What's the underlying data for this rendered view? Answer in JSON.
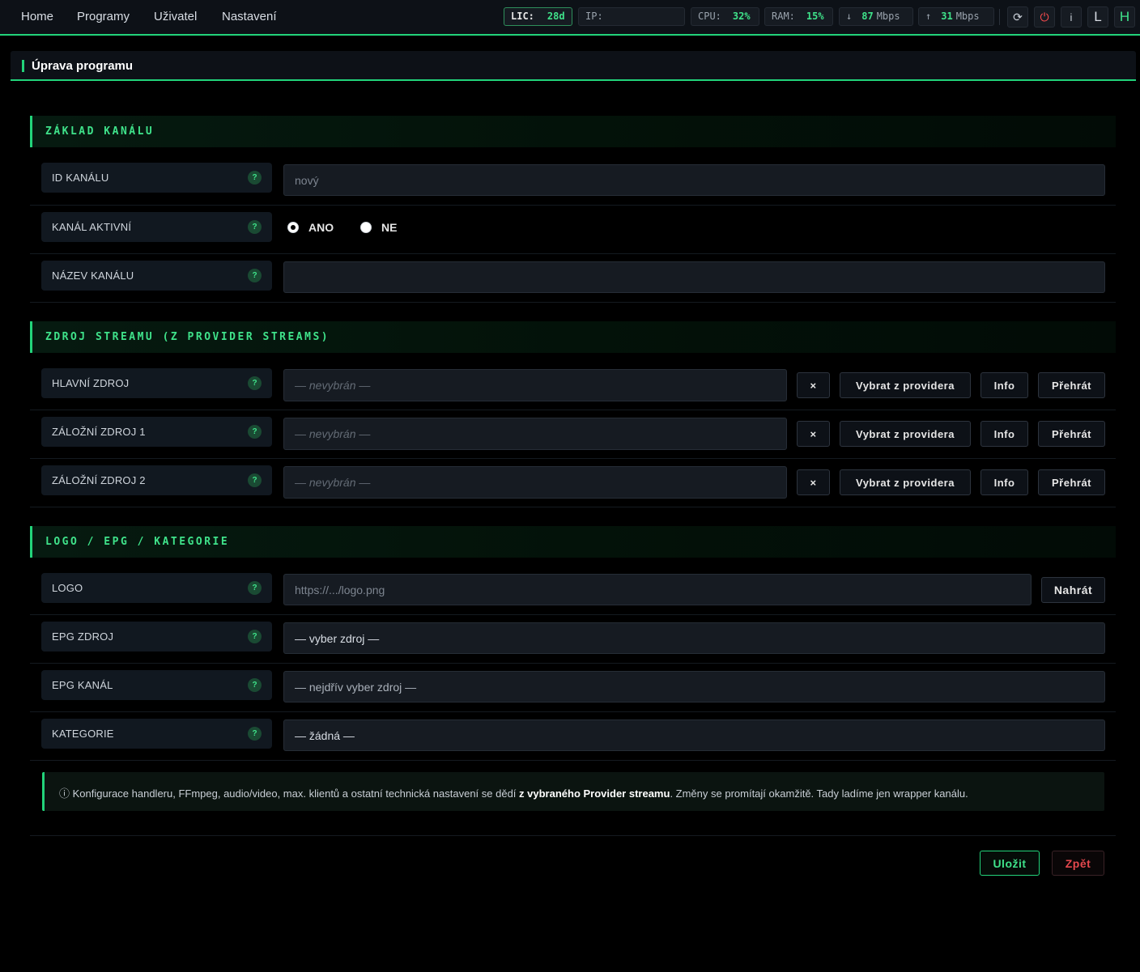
{
  "nav": {
    "items": [
      "Home",
      "Programy",
      "Uživatel",
      "Nastavení"
    ]
  },
  "status": {
    "lic_label": "LIC:",
    "lic_value": "28d",
    "ip_label": "IP:",
    "ip_value": "",
    "cpu_label": "CPU:",
    "cpu_value": "32%",
    "ram_label": "RAM:",
    "ram_value": "15%",
    "down_arrow": "↓",
    "down_value": "87",
    "down_unit": "Mbps",
    "up_arrow": "↑",
    "up_value": "31",
    "up_unit": "Mbps"
  },
  "toolbar": {
    "refresh_icon": "⟳",
    "power_icon": "⏻",
    "info_label": "i",
    "l_label": "L",
    "h_label": "H"
  },
  "page": {
    "title": "Úprava programu"
  },
  "help_symbol": "?",
  "sections": {
    "basic": {
      "title": "ZÁKLAD KANÁLU",
      "id_label": "ID KANÁLU",
      "id_placeholder": "nový",
      "active_label": "KANÁL AKTIVNÍ",
      "yes": "ANO",
      "no": "NE",
      "active_value": "ANO",
      "name_label": "NÁZEV KANÁLU",
      "name_value": ""
    },
    "stream": {
      "title": "ZDROJ STREAMU (Z PROVIDER STREAMS)",
      "rows": [
        {
          "label": "HLAVNÍ ZDROJ",
          "placeholder": "— nevybrán —"
        },
        {
          "label": "ZÁLOŽNÍ ZDROJ 1",
          "placeholder": "— nevybrán —"
        },
        {
          "label": "ZÁLOŽNÍ ZDROJ 2",
          "placeholder": "— nevybrán —"
        }
      ],
      "clear_label": "×",
      "pick_label": "Vybrat z providera",
      "info_label": "Info",
      "play_label": "Přehrát"
    },
    "meta": {
      "title": "LOGO / EPG / KATEGORIE",
      "logo_label": "LOGO",
      "logo_placeholder": "https://.../logo.png",
      "upload_label": "Nahrát",
      "epg_source_label": "EPG ZDROJ",
      "epg_source_value": "— vyber zdroj —",
      "epg_channel_label": "EPG KANÁL",
      "epg_channel_value": "— nejdřív vyber zdroj —",
      "category_label": "KATEGORIE",
      "category_value": "— žádná —"
    }
  },
  "note": {
    "icon": "ⓘ",
    "text_before": "Konfigurace handleru, FFmpeg, audio/video, max. klientů a ostatní technická nastavení se dědí ",
    "bold": "z vybraného Provider streamu",
    "text_after": ". Změny se promítají okamžitě. Tady ladíme jen wrapper kanálu."
  },
  "actions": {
    "save": "Uložit",
    "back": "Zpět"
  },
  "colors": {
    "accent": "#22d37a",
    "accent_text": "#3fe28a",
    "danger": "#e5484d",
    "background": "#000000",
    "panel": "#111820"
  }
}
